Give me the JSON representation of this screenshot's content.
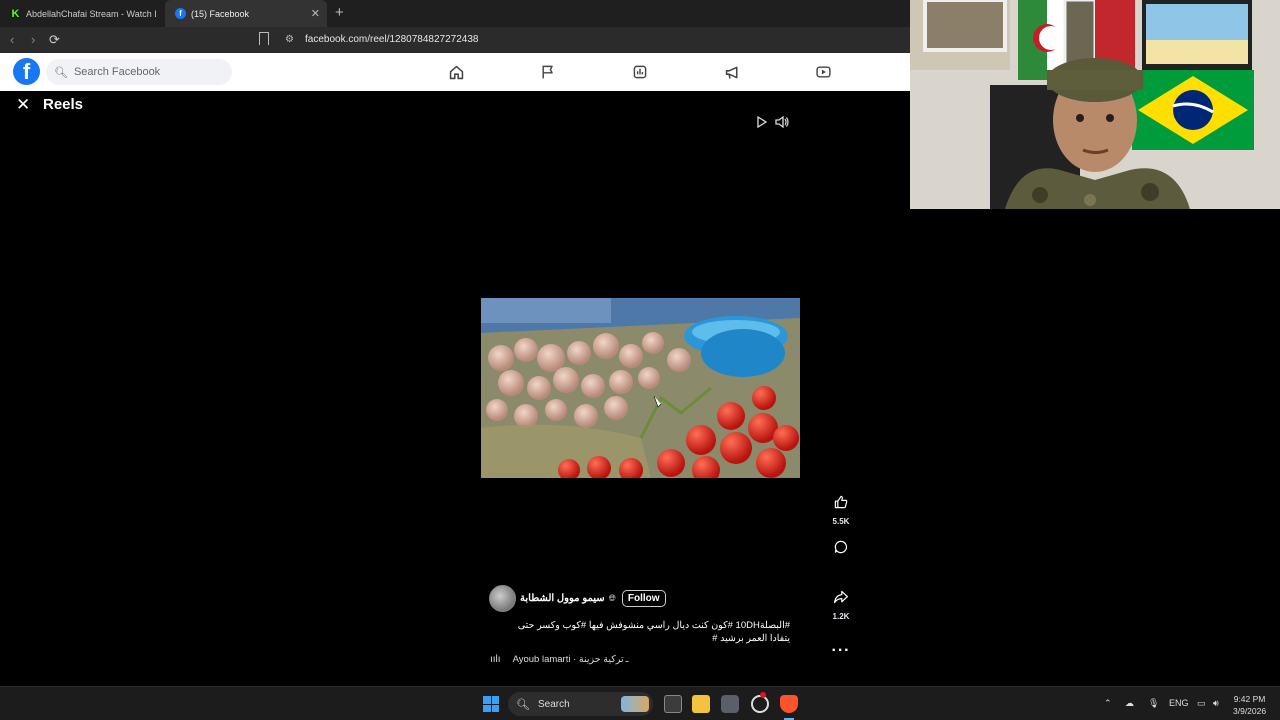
{
  "browser": {
    "tabs": [
      {
        "label": "AbdellahChafai Stream - Watch Live o",
        "icon": "kick-icon"
      },
      {
        "label": "(15) Facebook",
        "icon": "facebook-icon"
      }
    ],
    "url": "facebook.com/reel/1280784827272438"
  },
  "facebook": {
    "search_placeholder": "Search Facebook",
    "nav_icons": [
      "home-icon",
      "flag-icon",
      "feeds-icon",
      "megaphone-icon",
      "video-icon"
    ]
  },
  "reels": {
    "title": "Reels",
    "likes": "5.5K",
    "shares": "1.2K",
    "author": "سيمو موول الشطابة",
    "follow_label": "Follow",
    "caption": "#البصلة10DH #كون كنت ديال راسي منشوفش فيها #كوب وكسر حتى يتفادا العمر برشيد #",
    "audio_title": "Ayoub lamarti · تركية حزينة",
    "audio_title_end": "ـ"
  },
  "taskbar": {
    "search_label": "Search",
    "language": "ENG",
    "time": "9:42 PM",
    "date": "3/9/2026"
  },
  "colors": {
    "facebook_blue": "#1877f2",
    "windows_blue": "#3aa0f3"
  }
}
